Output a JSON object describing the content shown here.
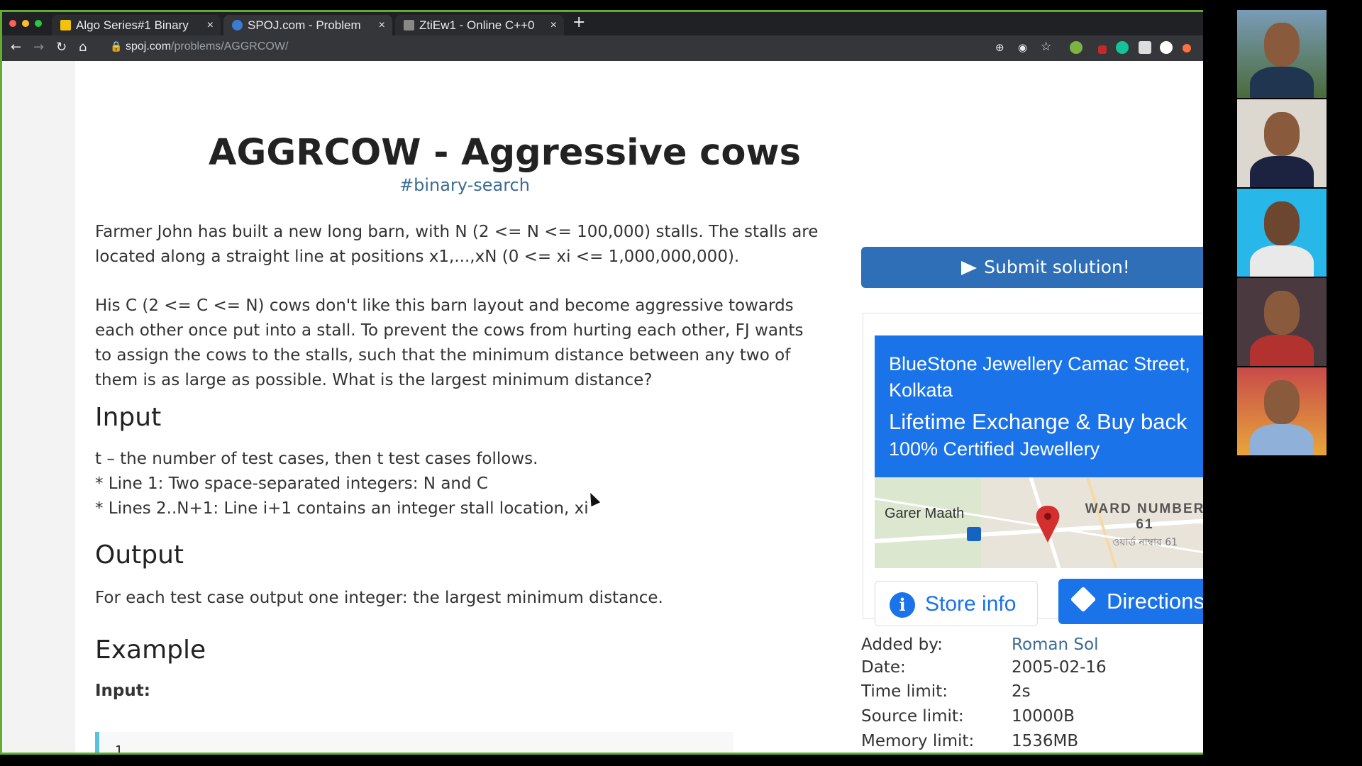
{
  "browser": {
    "tabs": [
      {
        "label": "Algo Series#1 Binary",
        "icon_color": "#f4c20d"
      },
      {
        "label": "SPOJ.com - Problem",
        "icon_color": "#3b7bd4"
      },
      {
        "label": "ZtiEw1 - Online C++0",
        "icon_color": "#888888"
      }
    ],
    "url_host": "spoj.com",
    "url_path": "/problems/AGGRCOW/"
  },
  "problem": {
    "title": "AGGRCOW - Aggressive cows",
    "tag": "#binary-search",
    "para1": "Farmer John has built a new long barn, with N (2 <= N <= 100,000) stalls. The stalls are located along a straight line at positions x1,...,xN (0 <= xi <= 1,000,000,000).",
    "para2": "His C (2 <= C <= N) cows don't like this barn layout and become aggressive towards each other once put into a stall. To prevent the cows from hurting each other, FJ wants to assign the cows to the stalls, such that the minimum distance between any two of them is as large as possible. What is the largest minimum distance?",
    "input_heading": "Input",
    "input_lines": [
      "t – the number of test cases, then t test cases follows.",
      "* Line 1: Two space-separated integers: N and C",
      "* Lines 2..N+1: Line i+1 contains an integer stall location, xi"
    ],
    "output_heading": "Output",
    "output_text": "For each test case output one integer: the largest minimum distance.",
    "example_heading": "Example",
    "example_input_label": "Input:",
    "example_first_line": "1"
  },
  "sidebar": {
    "submit_label": "Submit solution!",
    "ad": {
      "name": "BlueStone Jewellery Camac Street, Kolkata",
      "offer": "Lifetime Exchange & Buy back",
      "sub": "100% Certified Jewellery",
      "map_place1": "Garer Maath",
      "map_place2": "WARD NUMBER 61",
      "map_place3": "ওয়ার্ড নাম্বার 61",
      "store_info_label": "Store info",
      "directions_label": "Directions"
    },
    "meta": [
      {
        "label": "Added by:",
        "value": "Roman Sol"
      },
      {
        "label": "Date:",
        "value": "2005-02-16"
      },
      {
        "label": "Time limit:",
        "value": "2s"
      },
      {
        "label": "Source limit:",
        "value": "10000B"
      },
      {
        "label": "Memory limit:",
        "value": "1536MB"
      }
    ]
  }
}
